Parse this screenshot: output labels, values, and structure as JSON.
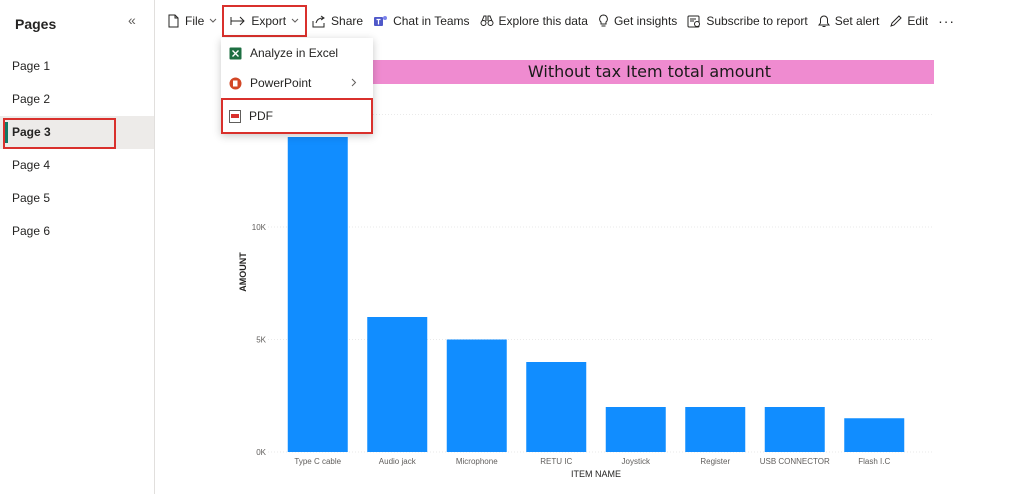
{
  "sidebar": {
    "title": "Pages",
    "collapse_icon": "double-chevron-left-icon",
    "pages": [
      "Page 1",
      "Page 2",
      "Page 3",
      "Page 4",
      "Page 5",
      "Page 6"
    ],
    "active_page": "Page 3"
  },
  "toolbar": {
    "file": "File",
    "export": "Export",
    "share": "Share",
    "chat_in_teams": "Chat in Teams",
    "explore": "Explore this data",
    "insights": "Get insights",
    "subscribe": "Subscribe to report",
    "alert": "Set alert",
    "edit": "Edit",
    "more": "···"
  },
  "export_menu": {
    "items": [
      "Analyze in Excel",
      "PowerPoint",
      "PDF"
    ]
  },
  "colors": {
    "bar": "#118dff",
    "title_bg": "#ef8bd0",
    "highlight": "#d9302c",
    "active_marker": "#117865"
  },
  "chart_data": {
    "type": "bar",
    "title": "Without tax Item total amount",
    "xlabel": "ITEM NAME",
    "ylabel": "AMOUNT",
    "categories": [
      "Type C cable",
      "Audio jack",
      "Microphone",
      "RETU IC",
      "Joystick",
      "Register",
      "USB CONNECTOR",
      "Flash I.C"
    ],
    "values": [
      14000,
      6000,
      5000,
      4000,
      2000,
      2000,
      2000,
      1500
    ],
    "y_ticks": [
      0,
      5000,
      10000
    ],
    "y_tick_labels": [
      "0K",
      "5K",
      "10K"
    ],
    "ylim": [
      0,
      15000
    ],
    "grid": true
  }
}
